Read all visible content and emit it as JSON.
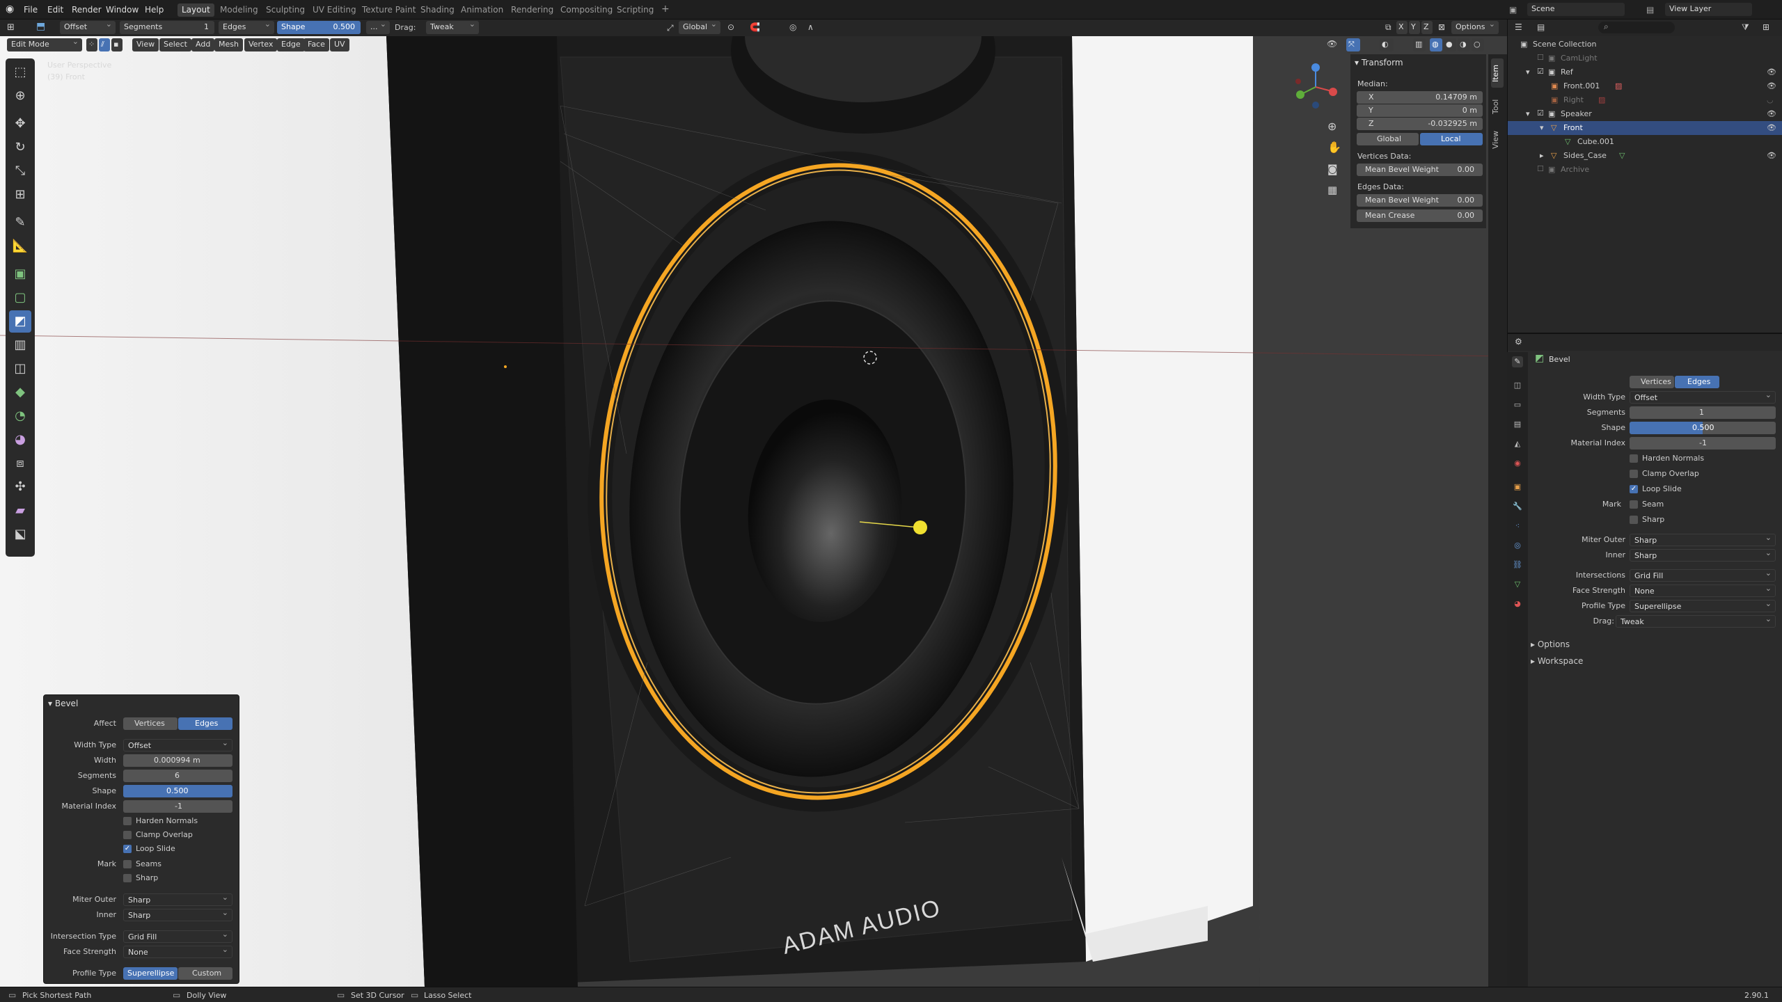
{
  "menu": {
    "items": [
      "File",
      "Edit",
      "Render",
      "Window",
      "Help"
    ]
  },
  "workspaces": {
    "items": [
      "Layout",
      "Modeling",
      "Sculpting",
      "UV Editing",
      "Texture Paint",
      "Shading",
      "Animation",
      "Rendering",
      "Compositing",
      "Scripting"
    ],
    "add": "+"
  },
  "topright": {
    "scene": "Scene",
    "view_layer": "View Layer"
  },
  "tool_header": {
    "width_type": "Offset",
    "segments_label": "Segments",
    "segments_value": "1",
    "affect": "Edges",
    "shape_label": "Shape",
    "shape_value": "0.500",
    "more": "...",
    "drag_label": "Drag:",
    "drag_value": "Tweak",
    "orientation": "Global",
    "axes": [
      "X",
      "Y",
      "Z"
    ],
    "options": "Options"
  },
  "mode_header": {
    "mode": "Edit Mode",
    "menus": [
      "View",
      "Select",
      "Add",
      "Mesh",
      "Vertex",
      "Edge",
      "Face",
      "UV"
    ]
  },
  "viewport": {
    "view_name": "User Perspective",
    "object_name": "(39) Front",
    "brand": "ADAM AUDIO"
  },
  "npanel": {
    "title": "Transform",
    "median": "Median:",
    "x_label": "X",
    "x_value": "0.14709 m",
    "y_label": "Y",
    "y_value": "0 m",
    "z_label": "Z",
    "z_value": "-0.032925 m",
    "global": "Global",
    "local": "Local",
    "vertices_data": "Vertices Data:",
    "mean_bevel_weight": "Mean Bevel Weight",
    "vbw_value": "0.00",
    "edges_data": "Edges Data:",
    "ebw_value": "0.00",
    "mean_crease": "Mean Crease",
    "crease_value": "0.00",
    "tabs": [
      "Item",
      "Tool",
      "View"
    ]
  },
  "outliner": {
    "rows": [
      "Scene Collection",
      "CamLight",
      "Ref",
      "Front.001",
      "Right",
      "Speaker",
      "Front",
      "Cube.001",
      "Sides_Case",
      "Archive"
    ]
  },
  "properties": {
    "title": "Bevel",
    "affect_label": "Affect",
    "vertices": "Vertices",
    "edges": "Edges",
    "width_type_label": "Width Type",
    "width_type": "Offset",
    "segments_label": "Segments",
    "segments": "1",
    "shape_label": "Shape",
    "shape": "0.500",
    "material_index_label": "Material Index",
    "material_index": "-1",
    "harden_normals": "Harden Normals",
    "clamp_overlap": "Clamp Overlap",
    "loop_slide": "Loop Slide",
    "mark_label": "Mark",
    "seam": "Seam",
    "sharp": "Sharp",
    "miter_outer_label": "Miter Outer",
    "miter_outer": "Sharp",
    "inner_label": "Inner",
    "inner": "Sharp",
    "intersections_label": "Intersections",
    "intersections": "Grid Fill",
    "face_strength_label": "Face Strength",
    "face_strength": "None",
    "profile_type_label": "Profile Type",
    "profile_type": "Superellipse",
    "drag_label": "Drag:",
    "drag": "Tweak",
    "options": "Options",
    "workspace": "Workspace"
  },
  "redo": {
    "title": "Bevel",
    "affect_label": "Affect",
    "vertices": "Vertices",
    "edges": "Edges",
    "width_type_label": "Width Type",
    "width_type": "Offset",
    "width_label": "Width",
    "width": "0.000994 m",
    "segments_label": "Segments",
    "segments": "6",
    "shape_label": "Shape",
    "shape": "0.500",
    "material_index_label": "Material Index",
    "material_index": "-1",
    "harden_normals": "Harden Normals",
    "clamp_overlap": "Clamp Overlap",
    "loop_slide": "Loop Slide",
    "mark_label": "Mark",
    "seams": "Seams",
    "sharp": "Sharp",
    "miter_outer_label": "Miter Outer",
    "miter_outer": "Sharp",
    "inner_label": "Inner",
    "inner": "Sharp",
    "intersection_type_label": "Intersection Type",
    "intersection_type": "Grid Fill",
    "face_strength_label": "Face Strength",
    "face_strength": "None",
    "profile_type_label": "Profile Type",
    "superellipse": "Superellipse",
    "custom": "Custom"
  },
  "status": {
    "left": "Pick Shortest Path",
    "mid": "Dolly View",
    "cursor": "Set 3D Cursor",
    "lasso": "Lasso Select",
    "version": "2.90.1"
  },
  "colors": {
    "accent": "#4772b3",
    "selection": "#f5a623",
    "active_object": "#e8b04a"
  }
}
